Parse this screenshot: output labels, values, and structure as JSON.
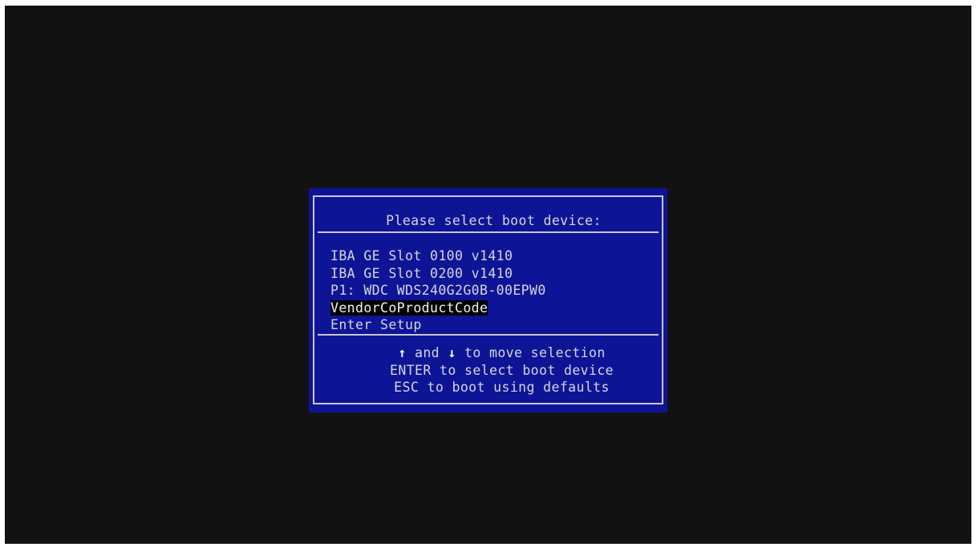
{
  "dialog": {
    "title": "Please select boot device:",
    "devices": [
      {
        "label": "IBA GE Slot 0100 v1410",
        "selected": false
      },
      {
        "label": "IBA GE Slot 0200 v1410",
        "selected": false
      },
      {
        "label": "P1: WDC WDS240G2G0B-00EPW0",
        "selected": false
      },
      {
        "label": "VendorCoProductCode",
        "selected": true
      },
      {
        "label": "Enter Setup",
        "selected": false
      }
    ],
    "help": {
      "up_arrow": "↑",
      "and_text": " and ",
      "down_arrow": "↓",
      "move_text": " to move selection",
      "enter_line": "ENTER to select boot device",
      "esc_line": "ESC to boot using defaults"
    }
  },
  "colors": {
    "screen_background": "#121212",
    "dialog_background": "#0e1496",
    "frame_line": "#c8c8d8",
    "text": "#d6d6de",
    "selection_background": "#000000"
  }
}
